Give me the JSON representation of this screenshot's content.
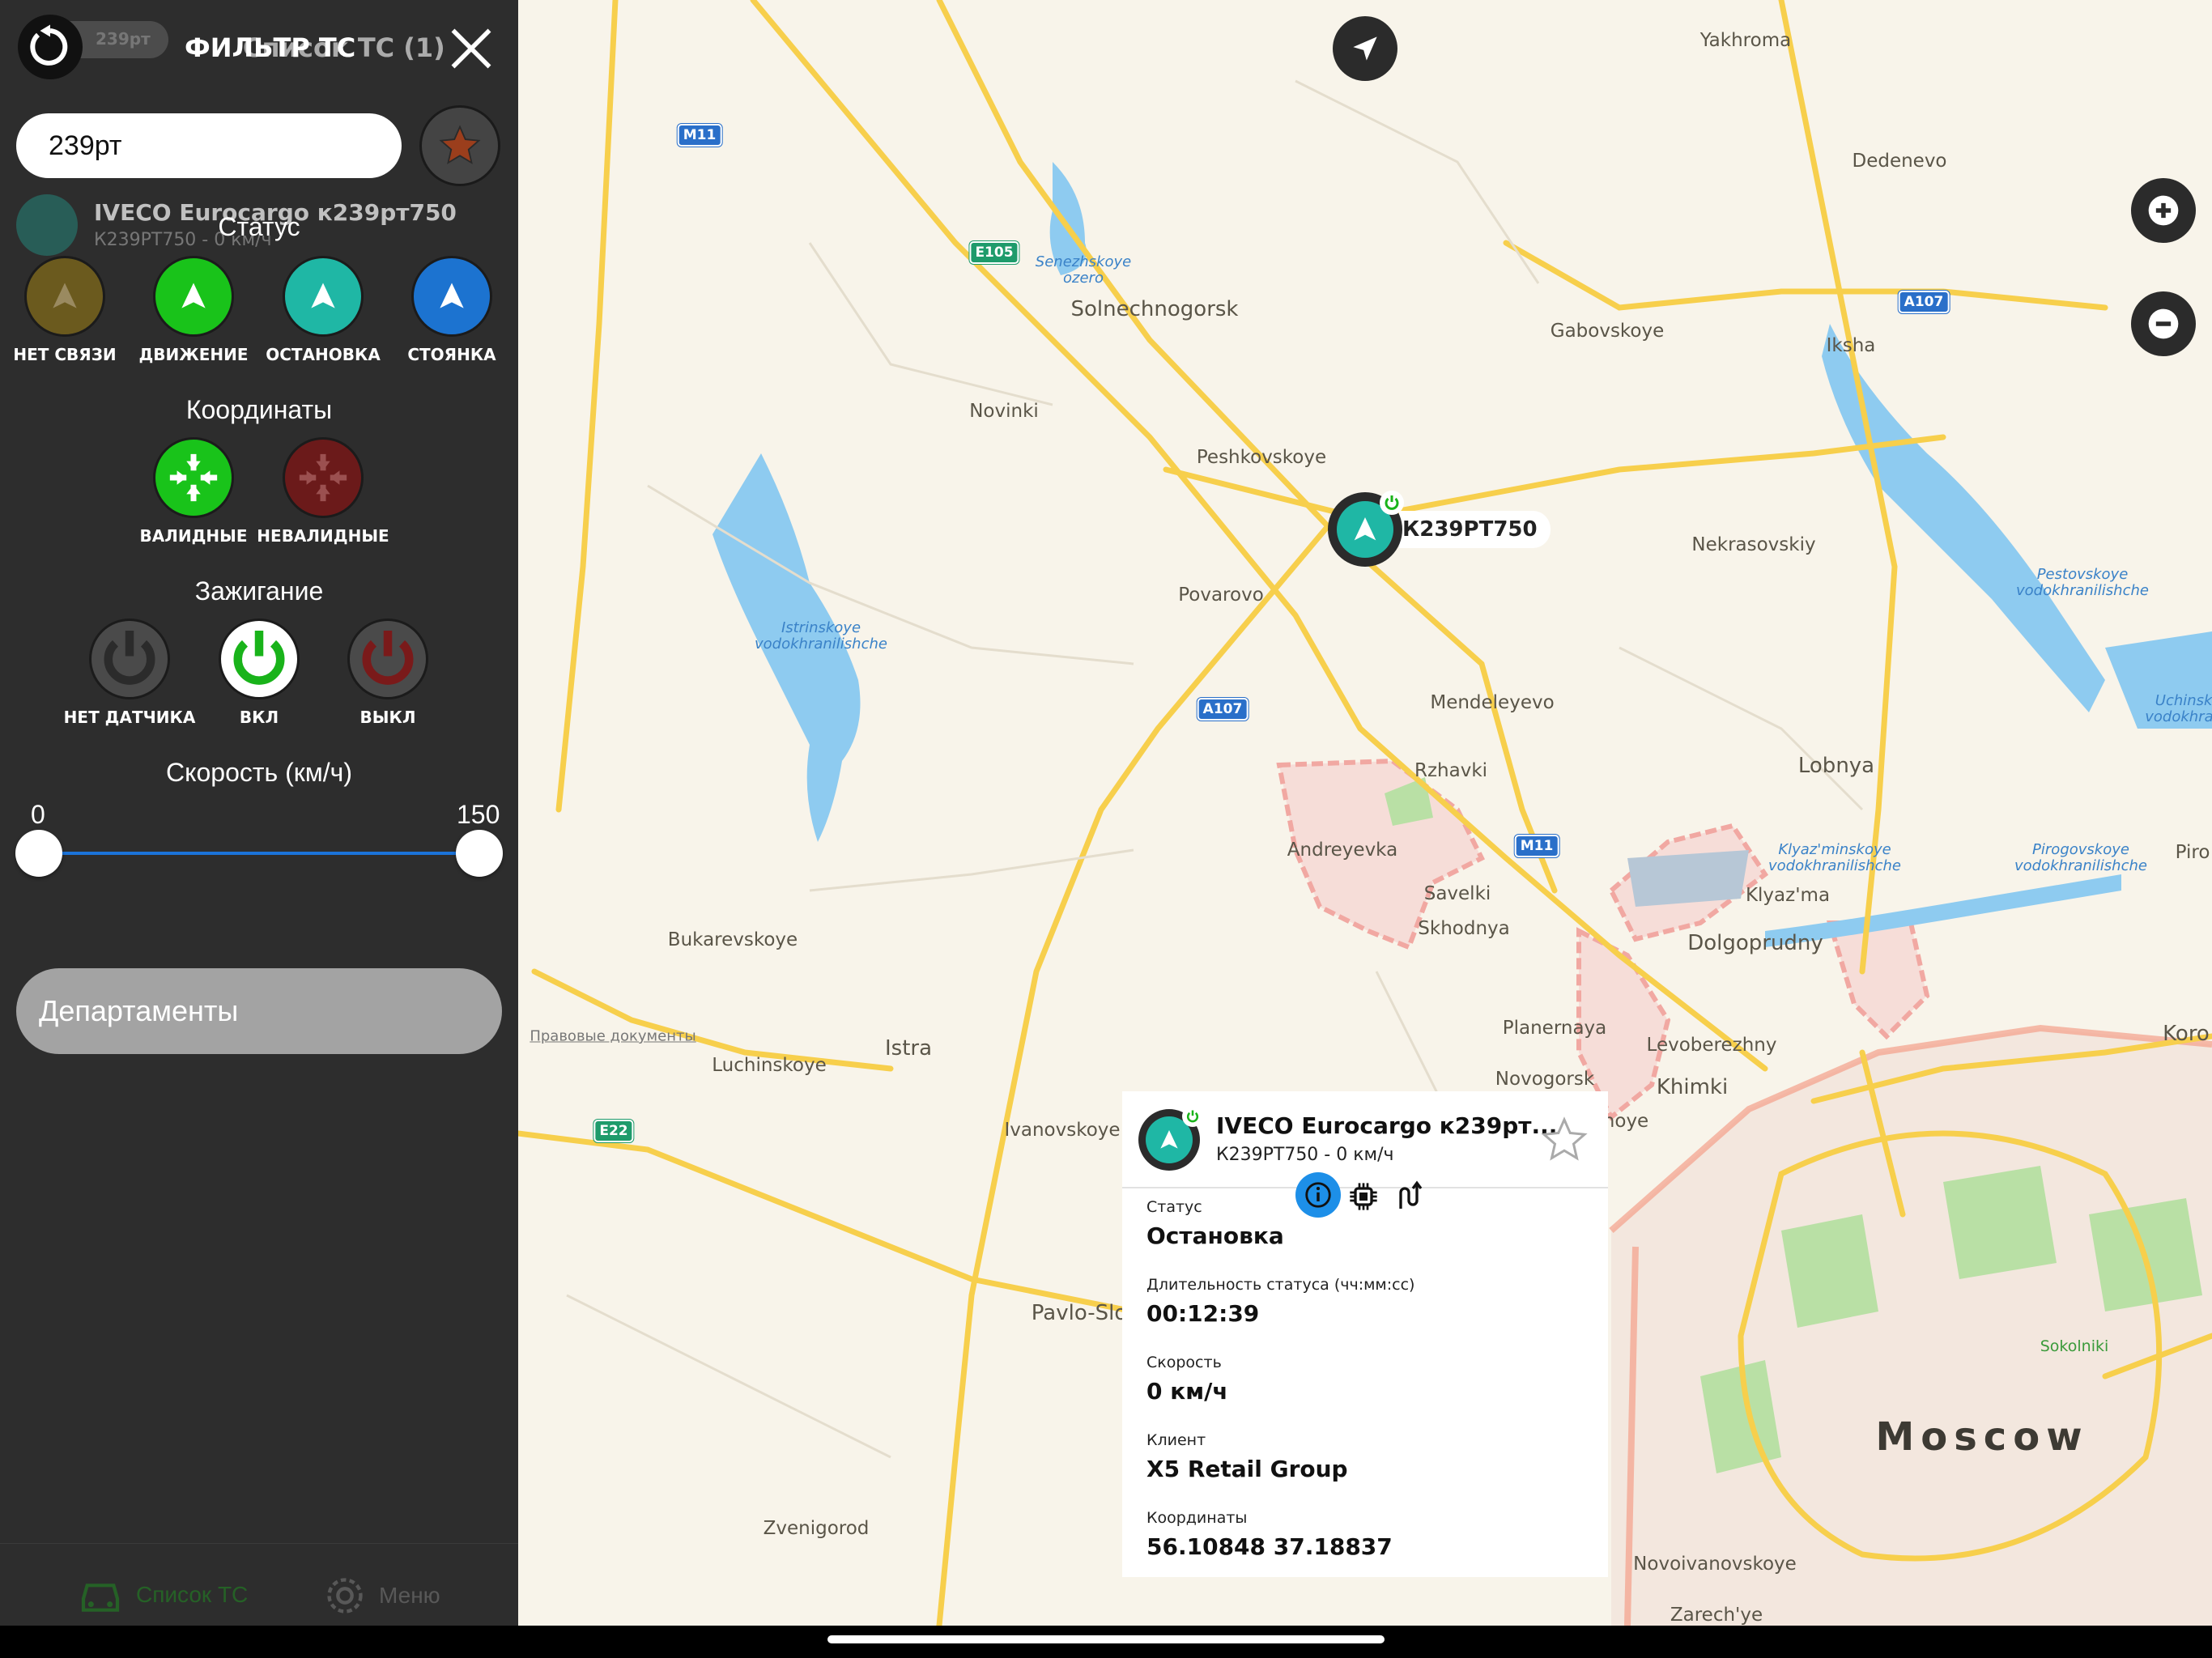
{
  "panel": {
    "title": "ФИЛЬТР ТС",
    "ghost_title": "Список ТС (1)",
    "ghost_badge": "239рт",
    "search_value": "239рт",
    "ghost_vehicle_name": "IVECO Eurocargo к239рт750",
    "ghost_vehicle_sub": "К239РТ750 - 0 км/ч",
    "status_title": "Статус",
    "status_items": [
      {
        "label": "НЕТ СВЯЗИ",
        "color": "#6b5a1e"
      },
      {
        "label": "ДВИЖЕНИЕ",
        "color": "#19c31a"
      },
      {
        "label": "ОСТАНОВКА",
        "color": "#1fb7a5"
      },
      {
        "label": "СТОЯНКА",
        "color": "#1c73d0"
      }
    ],
    "coords_title": "Координаты",
    "coords_items": [
      {
        "label": "ВАЛИДНЫЕ",
        "color": "#19c31a"
      },
      {
        "label": "НЕВАЛИДНЫЕ",
        "color": "#6b1a1a"
      }
    ],
    "ignition_title": "Зажигание",
    "ignition_items": [
      {
        "label": "НЕТ ДАТЧИКА"
      },
      {
        "label": "ВКЛ"
      },
      {
        "label": "ВЫКЛ"
      }
    ],
    "speed_title": "Скорость (км/ч)",
    "speed_min": "0",
    "speed_max": "150",
    "departments": "Департаменты",
    "tab_list": "Список ТС",
    "tab_menu": "Меню"
  },
  "map": {
    "marker_plate": "К239РТ750",
    "labels": {
      "yakhroma": "Yakhroma",
      "dedenevo": "Dedenevo",
      "iksha": "Iksha",
      "gabovskoye": "Gabovskoye",
      "solnechnogorsk": "Solnechnogorsk",
      "senezh": "Senezhskoye ozero",
      "novinki": "Novinki",
      "peshkovskoye": "Peshkovskoye",
      "nekrasovskiy": "Nekrasovskiy",
      "pestovskoye": "Pestovskoye vodokhranilishche",
      "povarovo": "Povarovo",
      "istrinskoye": "Istrinskoye vodokhranilishche",
      "mendeleyevo": "Mendeleyevo",
      "uchinsk": "Uchinsk. vodokhran.",
      "lobnya": "Lobnya",
      "rzhavki": "Rzhavki",
      "andreyevka": "Andreyevka",
      "savelki": "Savelki",
      "skhodnya": "Skhodnya",
      "klyazminskoye": "Klyaz'minskoye vodokhranilishche",
      "pirogovskoye": "Pirogovskoye vodokhranilishche",
      "klyazma": "Klyaz'ma",
      "piro": "Piro",
      "dolgoprudny": "Dolgoprudny",
      "bukarevskoye": "Bukarevskoye",
      "planernaya": "Planernaya",
      "levoberezhny": "Levoberezhny",
      "koro": "Koro",
      "legal": "Правовые документы",
      "luchinskoye": "Luchinskoye",
      "istra": "Istra",
      "khimki": "Khimki",
      "novogorsk": "Novogorsk",
      "ivanovskoye": "Ivanovskoye",
      "pavlo": "Pavlo-Slo",
      "sokolniki": "Sokolniki",
      "moscow": "Moscow",
      "zvenigorod": "Zvenigorod",
      "novoivanovskoye": "Novoivanovskoye",
      "zarechye": "Zarech'ye",
      "noye": "noye"
    },
    "shields": {
      "m11a": "M11",
      "e105": "E105",
      "a107a": "A107",
      "a107b": "A107",
      "m11b": "M11",
      "e22": "E22"
    }
  },
  "card": {
    "title": "IVECO Eurocargo к239рт...",
    "subtitle": "К239РТ750 - 0 км/ч",
    "fields": [
      {
        "label": "Статус",
        "value": "Остановка"
      },
      {
        "label": "Длительность статуса (чч:мм:сс)",
        "value": "00:12:39"
      },
      {
        "label": "Скорость",
        "value": "0 км/ч"
      },
      {
        "label": "Клиент",
        "value": "X5 Retail Group"
      },
      {
        "label": "Координаты",
        "value": "56.10848 37.18837"
      }
    ]
  }
}
